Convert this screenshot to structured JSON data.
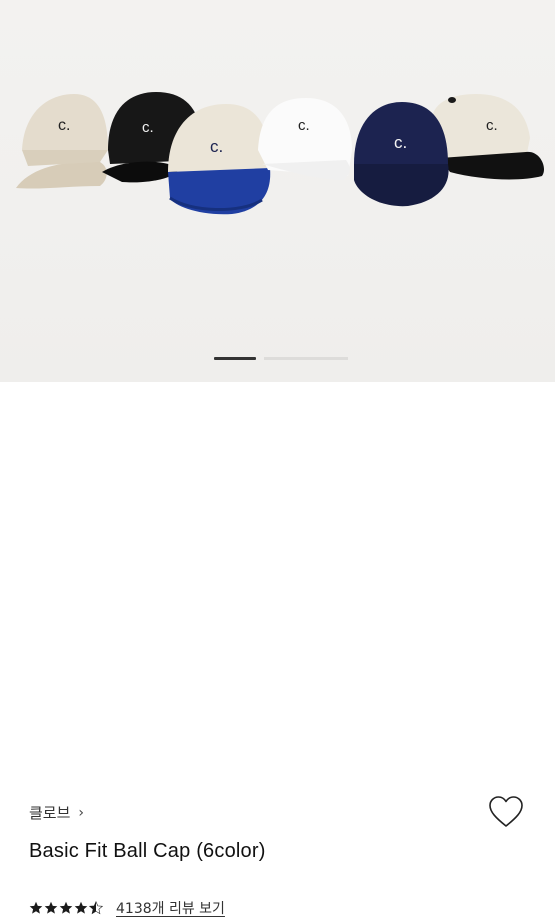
{
  "product_images": {
    "description_icon": "ball-cap-photo",
    "cap_logo": "c.",
    "active_slide": 1,
    "total_slides": 2
  },
  "brand": {
    "label": "클로브",
    "chevron": "›"
  },
  "product": {
    "title": "Basic Fit Ball Cap (6color)"
  },
  "rating": {
    "stars": 4.5,
    "reviews_label": "4138개 리뷰 보기"
  },
  "colors": {
    "accent": "#111111",
    "cap_navy": "#1c2350",
    "cap_blue_brim": "#1f3fa3",
    "cap_beige": "#e6dfd1"
  }
}
